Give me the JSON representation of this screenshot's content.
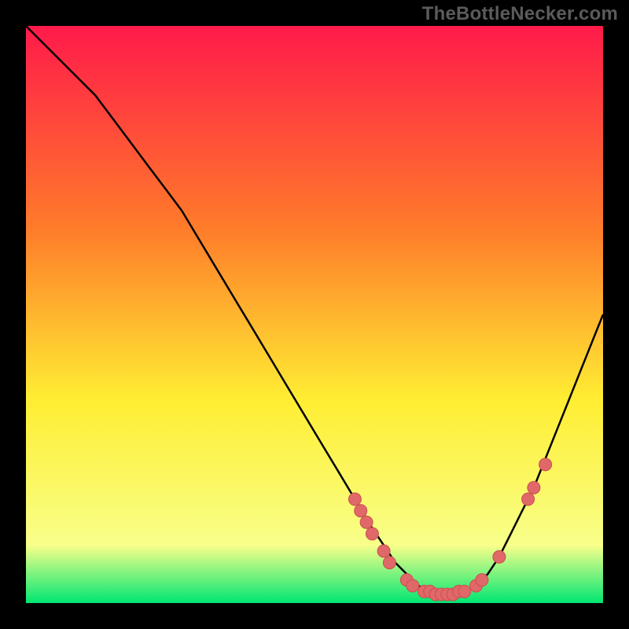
{
  "watermark": "TheBottleNecker.com",
  "colors": {
    "frame": "#000000",
    "curve": "#000000",
    "marker_fill": "#e06868",
    "marker_stroke": "#c94f4f",
    "gradient_top": "#ff1a4a",
    "gradient_mid1": "#ff7b2a",
    "gradient_mid2": "#ffee33",
    "gradient_low": "#f8ff8a",
    "gradient_bottom": "#00e673"
  },
  "chart_data": {
    "type": "line",
    "title": "",
    "xlabel": "",
    "ylabel": "",
    "xlim": [
      0,
      100
    ],
    "ylim": [
      0,
      100
    ],
    "series": [
      {
        "name": "bottleneck-curve",
        "x": [
          0,
          3,
          6,
          9,
          12,
          15,
          18,
          21,
          24,
          27,
          30,
          33,
          36,
          39,
          42,
          45,
          48,
          51,
          54,
          57,
          60,
          62,
          64,
          66,
          68,
          70,
          72,
          74,
          76,
          78,
          80,
          82,
          84,
          86,
          88,
          90,
          92,
          94,
          96,
          98,
          100
        ],
        "y": [
          100,
          97,
          94,
          91,
          88,
          84,
          80,
          76,
          72,
          68,
          63,
          58,
          53,
          48,
          43,
          38,
          33,
          28,
          23,
          18,
          13,
          10,
          7,
          5,
          3,
          2,
          1.5,
          1.5,
          2,
          3,
          5,
          8,
          12,
          16,
          20,
          25,
          30,
          35,
          40,
          45,
          50
        ]
      }
    ],
    "markers": {
      "name": "highlight-points",
      "points": [
        {
          "x": 57,
          "y": 18
        },
        {
          "x": 58,
          "y": 16
        },
        {
          "x": 59,
          "y": 14
        },
        {
          "x": 60,
          "y": 12
        },
        {
          "x": 62,
          "y": 9
        },
        {
          "x": 63,
          "y": 7
        },
        {
          "x": 66,
          "y": 4
        },
        {
          "x": 67,
          "y": 3
        },
        {
          "x": 69,
          "y": 2
        },
        {
          "x": 70,
          "y": 2
        },
        {
          "x": 71,
          "y": 1.5
        },
        {
          "x": 72,
          "y": 1.5
        },
        {
          "x": 73,
          "y": 1.5
        },
        {
          "x": 74,
          "y": 1.5
        },
        {
          "x": 75,
          "y": 2
        },
        {
          "x": 76,
          "y": 2
        },
        {
          "x": 78,
          "y": 3
        },
        {
          "x": 79,
          "y": 4
        },
        {
          "x": 82,
          "y": 8
        },
        {
          "x": 87,
          "y": 18
        },
        {
          "x": 88,
          "y": 20
        },
        {
          "x": 90,
          "y": 24
        }
      ]
    }
  }
}
